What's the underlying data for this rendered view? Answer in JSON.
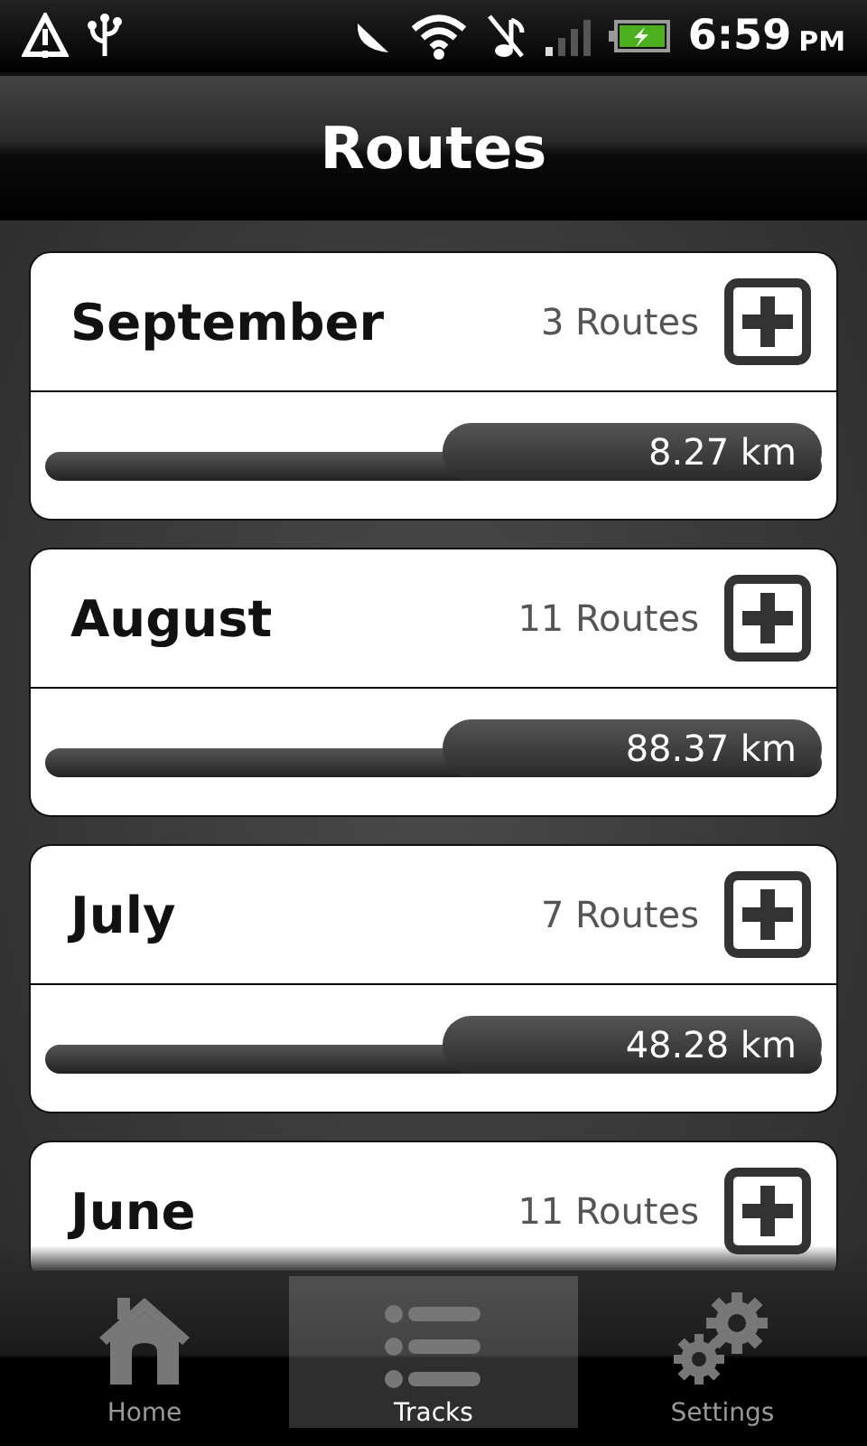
{
  "status_bar": {
    "time": "6:59",
    "ampm": "PM"
  },
  "title": "Routes",
  "months": [
    {
      "name": "September",
      "routes": "3 Routes",
      "distance": "8.27 km"
    },
    {
      "name": "August",
      "routes": "11 Routes",
      "distance": "88.37 km"
    },
    {
      "name": "July",
      "routes": "7 Routes",
      "distance": "48.28 km"
    },
    {
      "name": "June",
      "routes": "11 Routes"
    }
  ],
  "tabs": [
    {
      "kind": "home",
      "label": "Home",
      "selected": false
    },
    {
      "kind": "tracks",
      "label": "Tracks",
      "selected": true
    },
    {
      "kind": "settings",
      "label": "Settings",
      "selected": false
    }
  ]
}
